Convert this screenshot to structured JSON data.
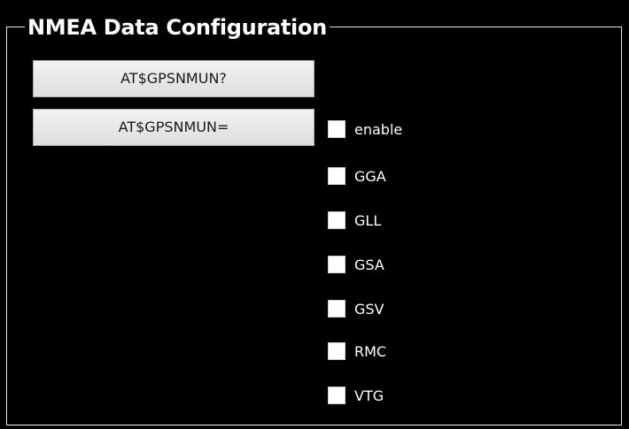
{
  "group": {
    "title": "NMEA Data Configuration"
  },
  "buttons": {
    "query_label": "AT$GPSNMUN?",
    "set_label": "AT$GPSNMUN="
  },
  "checkboxes": [
    {
      "label": "enable",
      "checked": false
    },
    {
      "label": "GGA",
      "checked": false
    },
    {
      "label": "GLL",
      "checked": false
    },
    {
      "label": "GSA",
      "checked": false
    },
    {
      "label": "GSV",
      "checked": false
    },
    {
      "label": "RMC",
      "checked": false
    },
    {
      "label": "VTG",
      "checked": false
    }
  ],
  "colors": {
    "panel_background": "#000000",
    "text": "#ffffff",
    "group_border": "#e6e6e6",
    "button_face": "#e6e6e6",
    "checkbox_fill": "#ffffff"
  }
}
